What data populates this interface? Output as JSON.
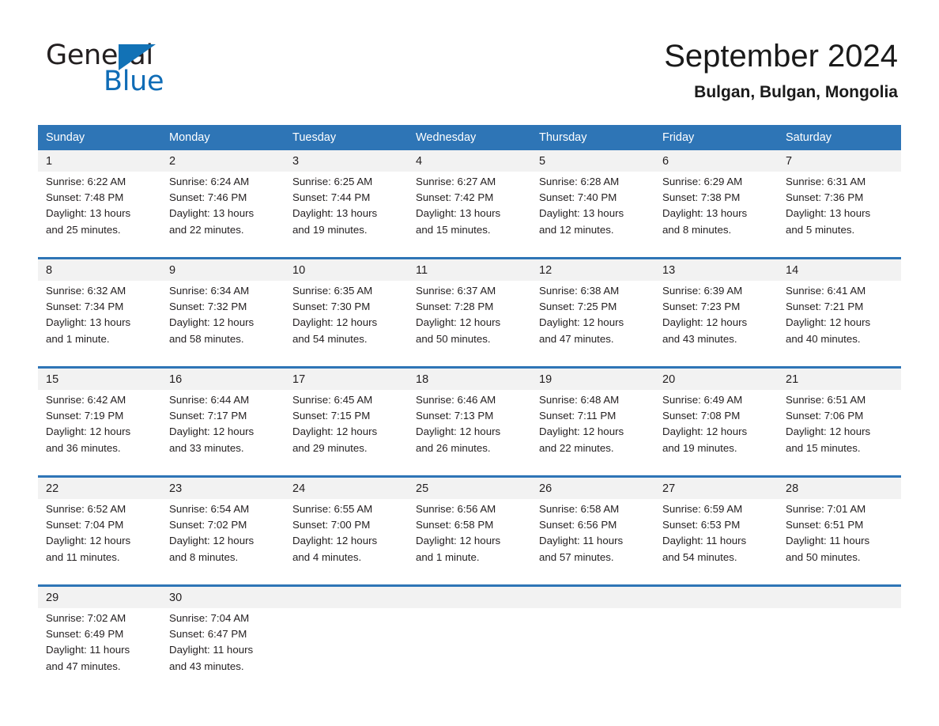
{
  "logo": {
    "word_dark": "General",
    "word_blue": "Blue",
    "accent_color": "#1272b6"
  },
  "header": {
    "month_title": "September 2024",
    "location": "Bulgan, Bulgan, Mongolia"
  },
  "theme": {
    "header_blue": "#2e75b6",
    "daynum_gray": "#f2f2f2",
    "text_dark": "#231f20"
  },
  "weekdays": [
    "Sunday",
    "Monday",
    "Tuesday",
    "Wednesday",
    "Thursday",
    "Friday",
    "Saturday"
  ],
  "labels": {
    "sunrise_prefix": "Sunrise:",
    "sunset_prefix": "Sunset:",
    "daylight_prefix": "Daylight:"
  },
  "weeks": [
    {
      "days": [
        {
          "date": "1",
          "sunrise": "Sunrise: 6:22 AM",
          "sunset": "Sunset: 7:48 PM",
          "daylight_1": "Daylight: 13 hours",
          "daylight_2": "and 25 minutes."
        },
        {
          "date": "2",
          "sunrise": "Sunrise: 6:24 AM",
          "sunset": "Sunset: 7:46 PM",
          "daylight_1": "Daylight: 13 hours",
          "daylight_2": "and 22 minutes."
        },
        {
          "date": "3",
          "sunrise": "Sunrise: 6:25 AM",
          "sunset": "Sunset: 7:44 PM",
          "daylight_1": "Daylight: 13 hours",
          "daylight_2": "and 19 minutes."
        },
        {
          "date": "4",
          "sunrise": "Sunrise: 6:27 AM",
          "sunset": "Sunset: 7:42 PM",
          "daylight_1": "Daylight: 13 hours",
          "daylight_2": "and 15 minutes."
        },
        {
          "date": "5",
          "sunrise": "Sunrise: 6:28 AM",
          "sunset": "Sunset: 7:40 PM",
          "daylight_1": "Daylight: 13 hours",
          "daylight_2": "and 12 minutes."
        },
        {
          "date": "6",
          "sunrise": "Sunrise: 6:29 AM",
          "sunset": "Sunset: 7:38 PM",
          "daylight_1": "Daylight: 13 hours",
          "daylight_2": "and 8 minutes."
        },
        {
          "date": "7",
          "sunrise": "Sunrise: 6:31 AM",
          "sunset": "Sunset: 7:36 PM",
          "daylight_1": "Daylight: 13 hours",
          "daylight_2": "and 5 minutes."
        }
      ]
    },
    {
      "days": [
        {
          "date": "8",
          "sunrise": "Sunrise: 6:32 AM",
          "sunset": "Sunset: 7:34 PM",
          "daylight_1": "Daylight: 13 hours",
          "daylight_2": "and 1 minute."
        },
        {
          "date": "9",
          "sunrise": "Sunrise: 6:34 AM",
          "sunset": "Sunset: 7:32 PM",
          "daylight_1": "Daylight: 12 hours",
          "daylight_2": "and 58 minutes."
        },
        {
          "date": "10",
          "sunrise": "Sunrise: 6:35 AM",
          "sunset": "Sunset: 7:30 PM",
          "daylight_1": "Daylight: 12 hours",
          "daylight_2": "and 54 minutes."
        },
        {
          "date": "11",
          "sunrise": "Sunrise: 6:37 AM",
          "sunset": "Sunset: 7:28 PM",
          "daylight_1": "Daylight: 12 hours",
          "daylight_2": "and 50 minutes."
        },
        {
          "date": "12",
          "sunrise": "Sunrise: 6:38 AM",
          "sunset": "Sunset: 7:25 PM",
          "daylight_1": "Daylight: 12 hours",
          "daylight_2": "and 47 minutes."
        },
        {
          "date": "13",
          "sunrise": "Sunrise: 6:39 AM",
          "sunset": "Sunset: 7:23 PM",
          "daylight_1": "Daylight: 12 hours",
          "daylight_2": "and 43 minutes."
        },
        {
          "date": "14",
          "sunrise": "Sunrise: 6:41 AM",
          "sunset": "Sunset: 7:21 PM",
          "daylight_1": "Daylight: 12 hours",
          "daylight_2": "and 40 minutes."
        }
      ]
    },
    {
      "days": [
        {
          "date": "15",
          "sunrise": "Sunrise: 6:42 AM",
          "sunset": "Sunset: 7:19 PM",
          "daylight_1": "Daylight: 12 hours",
          "daylight_2": "and 36 minutes."
        },
        {
          "date": "16",
          "sunrise": "Sunrise: 6:44 AM",
          "sunset": "Sunset: 7:17 PM",
          "daylight_1": "Daylight: 12 hours",
          "daylight_2": "and 33 minutes."
        },
        {
          "date": "17",
          "sunrise": "Sunrise: 6:45 AM",
          "sunset": "Sunset: 7:15 PM",
          "daylight_1": "Daylight: 12 hours",
          "daylight_2": "and 29 minutes."
        },
        {
          "date": "18",
          "sunrise": "Sunrise: 6:46 AM",
          "sunset": "Sunset: 7:13 PM",
          "daylight_1": "Daylight: 12 hours",
          "daylight_2": "and 26 minutes."
        },
        {
          "date": "19",
          "sunrise": "Sunrise: 6:48 AM",
          "sunset": "Sunset: 7:11 PM",
          "daylight_1": "Daylight: 12 hours",
          "daylight_2": "and 22 minutes."
        },
        {
          "date": "20",
          "sunrise": "Sunrise: 6:49 AM",
          "sunset": "Sunset: 7:08 PM",
          "daylight_1": "Daylight: 12 hours",
          "daylight_2": "and 19 minutes."
        },
        {
          "date": "21",
          "sunrise": "Sunrise: 6:51 AM",
          "sunset": "Sunset: 7:06 PM",
          "daylight_1": "Daylight: 12 hours",
          "daylight_2": "and 15 minutes."
        }
      ]
    },
    {
      "days": [
        {
          "date": "22",
          "sunrise": "Sunrise: 6:52 AM",
          "sunset": "Sunset: 7:04 PM",
          "daylight_1": "Daylight: 12 hours",
          "daylight_2": "and 11 minutes."
        },
        {
          "date": "23",
          "sunrise": "Sunrise: 6:54 AM",
          "sunset": "Sunset: 7:02 PM",
          "daylight_1": "Daylight: 12 hours",
          "daylight_2": "and 8 minutes."
        },
        {
          "date": "24",
          "sunrise": "Sunrise: 6:55 AM",
          "sunset": "Sunset: 7:00 PM",
          "daylight_1": "Daylight: 12 hours",
          "daylight_2": "and 4 minutes."
        },
        {
          "date": "25",
          "sunrise": "Sunrise: 6:56 AM",
          "sunset": "Sunset: 6:58 PM",
          "daylight_1": "Daylight: 12 hours",
          "daylight_2": "and 1 minute."
        },
        {
          "date": "26",
          "sunrise": "Sunrise: 6:58 AM",
          "sunset": "Sunset: 6:56 PM",
          "daylight_1": "Daylight: 11 hours",
          "daylight_2": "and 57 minutes."
        },
        {
          "date": "27",
          "sunrise": "Sunrise: 6:59 AM",
          "sunset": "Sunset: 6:53 PM",
          "daylight_1": "Daylight: 11 hours",
          "daylight_2": "and 54 minutes."
        },
        {
          "date": "28",
          "sunrise": "Sunrise: 7:01 AM",
          "sunset": "Sunset: 6:51 PM",
          "daylight_1": "Daylight: 11 hours",
          "daylight_2": "and 50 minutes."
        }
      ]
    },
    {
      "days": [
        {
          "date": "29",
          "sunrise": "Sunrise: 7:02 AM",
          "sunset": "Sunset: 6:49 PM",
          "daylight_1": "Daylight: 11 hours",
          "daylight_2": "and 47 minutes."
        },
        {
          "date": "30",
          "sunrise": "Sunrise: 7:04 AM",
          "sunset": "Sunset: 6:47 PM",
          "daylight_1": "Daylight: 11 hours",
          "daylight_2": "and 43 minutes."
        },
        {
          "date": "",
          "sunrise": "",
          "sunset": "",
          "daylight_1": "",
          "daylight_2": ""
        },
        {
          "date": "",
          "sunrise": "",
          "sunset": "",
          "daylight_1": "",
          "daylight_2": ""
        },
        {
          "date": "",
          "sunrise": "",
          "sunset": "",
          "daylight_1": "",
          "daylight_2": ""
        },
        {
          "date": "",
          "sunrise": "",
          "sunset": "",
          "daylight_1": "",
          "daylight_2": ""
        },
        {
          "date": "",
          "sunrise": "",
          "sunset": "",
          "daylight_1": "",
          "daylight_2": ""
        }
      ]
    }
  ]
}
